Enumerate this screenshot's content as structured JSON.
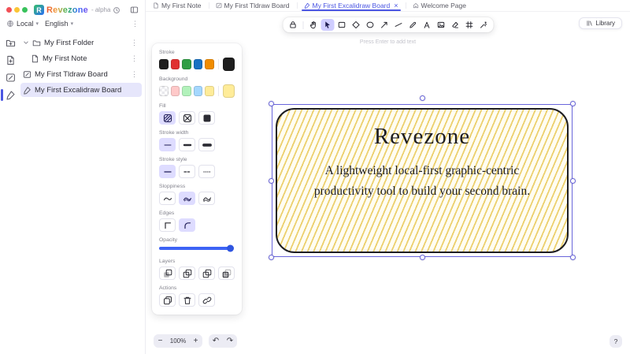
{
  "colors": {
    "accent": "#6965db",
    "slider": "#3d63f5",
    "tabActive": "#4a55e2",
    "railBar": "#4a55e2",
    "cardFill": "#ecd06e"
  },
  "icons": {
    "kebab": "⋮",
    "caret": "▾",
    "close": "×"
  },
  "header": {
    "logo_letter": "R",
    "app_name": "Revezone",
    "alpha": "- alpha",
    "workspace": "Local",
    "language": "English"
  },
  "tree": {
    "items": [
      {
        "label": "My First Folder"
      },
      {
        "label": "My First Note"
      },
      {
        "label": "My First Tldraw Board"
      },
      {
        "label": "My First Excalidraw Board"
      }
    ]
  },
  "tabs": [
    {
      "label": "My First Note"
    },
    {
      "label": "My First Tldraw Board"
    },
    {
      "label": "My First Excalidraw Board"
    },
    {
      "label": "Welcome Page"
    }
  ],
  "toolbar": {
    "hint": "Press Enter to add text",
    "library": "Library"
  },
  "panel": {
    "titles": {
      "stroke": "Stroke",
      "background": "Background",
      "fill": "Fill",
      "strokeWidth": "Stroke width",
      "strokeStyle": "Stroke style",
      "sloppiness": "Sloppiness",
      "edges": "Edges",
      "opacity": "Opacity",
      "layers": "Layers",
      "actions": "Actions"
    },
    "stroke_swatches": [
      "#1e1e1e",
      "#e03131",
      "#2f9e44",
      "#1971c2",
      "#f08c00"
    ],
    "stroke_current": "#1e1e1e",
    "background_swatches": [
      "transparent",
      "#ffc9c9",
      "#b2f2bb",
      "#a5d8ff",
      "#ffec99"
    ],
    "background_current": "#ffec99",
    "opacity_percent": 100
  },
  "card": {
    "title": "Revezone",
    "line1": "A lightweight local-first graphic-centric",
    "line2": "productivity tool to build your second brain."
  },
  "footer": {
    "zoom_out": "−",
    "zoom": "100%",
    "zoom_in": "+",
    "undo": "↶",
    "redo": "↷",
    "help": "?"
  }
}
